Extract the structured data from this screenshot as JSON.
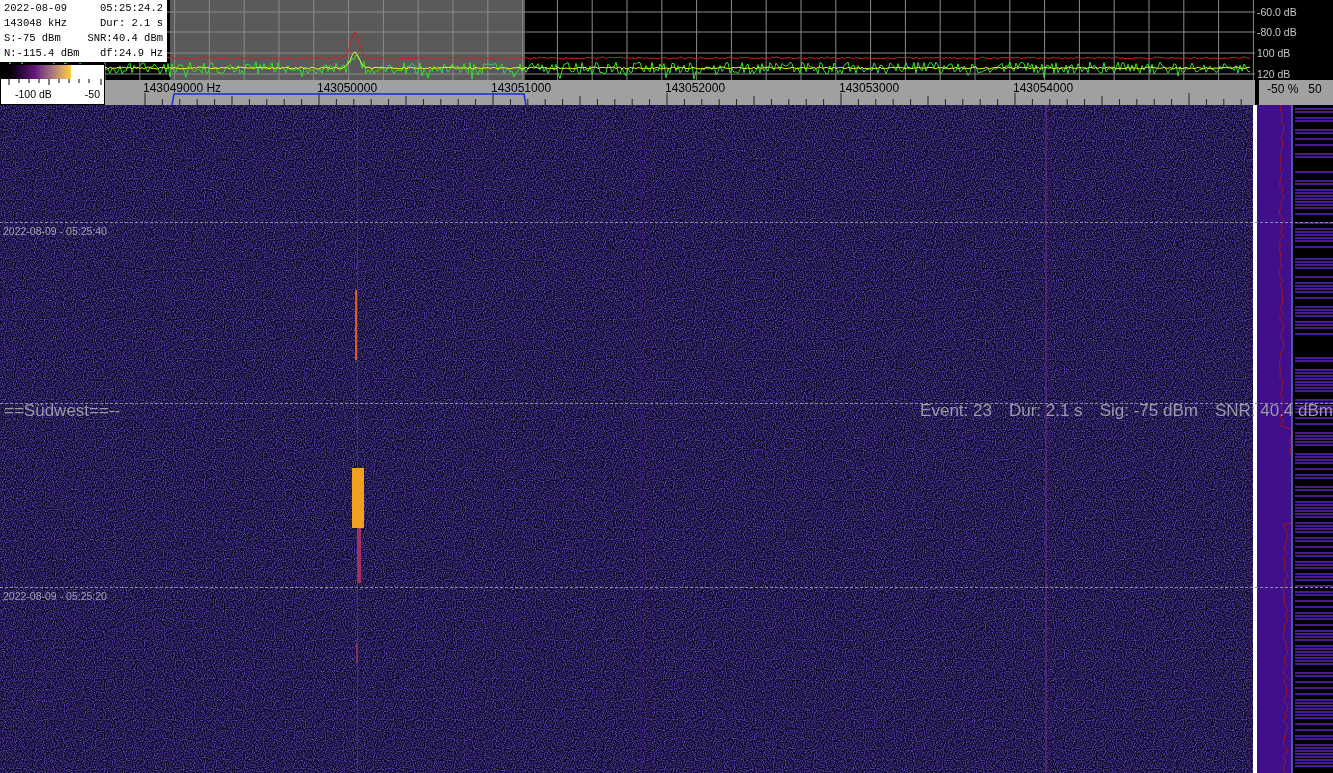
{
  "info_box": {
    "lines": [
      {
        "left": "2022-08-09",
        "right": "05:25:24.2"
      },
      {
        "left": "143048 kHz",
        "right": "Dur: 2.1 s"
      },
      {
        "left": "S:-75 dBm",
        "right": "SNR:40.4 dBm"
      },
      {
        "left": "N:-115.4 dBm",
        "right": "df:24.9 Hz"
      }
    ]
  },
  "color_scale": {
    "min_label": "-100 dB",
    "max_label": "-50"
  },
  "spectrum": {
    "db_labels": [
      "-60.0 dB",
      "-80.0 dB",
      "100 dB",
      "120 dB"
    ]
  },
  "frequency_axis": {
    "labels": [
      "143049000 Hz",
      "143050000",
      "143051000",
      "143052000",
      "143053000",
      "143054000"
    ]
  },
  "side_axis": {
    "labels": [
      "-50 %",
      "50"
    ]
  },
  "waterfall": {
    "time_labels": [
      "2022-08-09 - 05:25:40",
      "2022-08-09 - 05:25:20"
    ],
    "station_label": "==Südwest==--",
    "event_items": [
      "Event: 23",
      "Dur: 2.1 s",
      "Sig: -75 dBm",
      "SNR: 40.4 dBm"
    ]
  }
}
